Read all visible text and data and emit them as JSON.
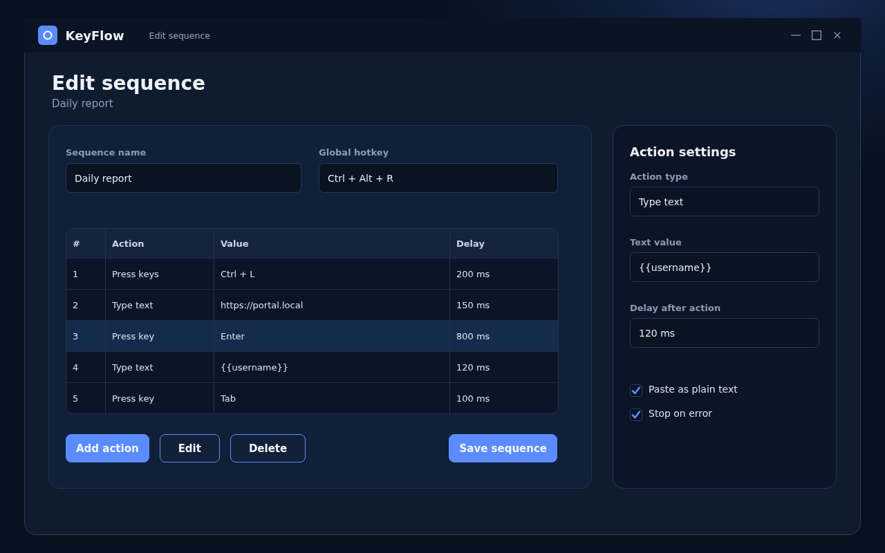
{
  "app": {
    "name": "KeyFlow",
    "breadcrumb": "Edit sequence"
  },
  "page": {
    "title": "Edit sequence",
    "subtitle": "Daily report"
  },
  "form": {
    "fields": [
      {
        "label": "Sequence name",
        "value": "Daily report"
      },
      {
        "label": "Global hotkey",
        "value": "Ctrl + Alt + R"
      }
    ]
  },
  "table": {
    "columns": [
      "#",
      "Action",
      "Value",
      "Delay"
    ],
    "rows": [
      {
        "cells": [
          "1",
          "Press keys",
          "Ctrl + L",
          "200 ms"
        ],
        "selected": false
      },
      {
        "cells": [
          "2",
          "Type text",
          "https://portal.local",
          "150 ms"
        ],
        "selected": false
      },
      {
        "cells": [
          "3",
          "Press key",
          "Enter",
          "800 ms"
        ],
        "selected": true
      },
      {
        "cells": [
          "4",
          "Type text",
          "{{username}}",
          "120 ms"
        ],
        "selected": false
      },
      {
        "cells": [
          "5",
          "Press key",
          "Tab",
          "100 ms"
        ],
        "selected": false
      }
    ]
  },
  "buttons": [
    {
      "label": "Add action",
      "kind": "primary"
    },
    {
      "label": "Edit",
      "kind": "outline"
    },
    {
      "label": "Delete",
      "kind": "outline"
    }
  ],
  "save_button": {
    "label": "Save sequence",
    "kind": "primary"
  },
  "settings": {
    "title": "Action settings",
    "fields": [
      {
        "label": "Action type",
        "value": "Type text"
      },
      {
        "label": "Text value",
        "value": "{{username}}"
      },
      {
        "label": "Delay after action",
        "value": "120 ms"
      }
    ],
    "checkboxes": [
      {
        "label": "Paste as plain text",
        "checked": true
      },
      {
        "label": "Stop on error",
        "checked": true
      }
    ]
  }
}
